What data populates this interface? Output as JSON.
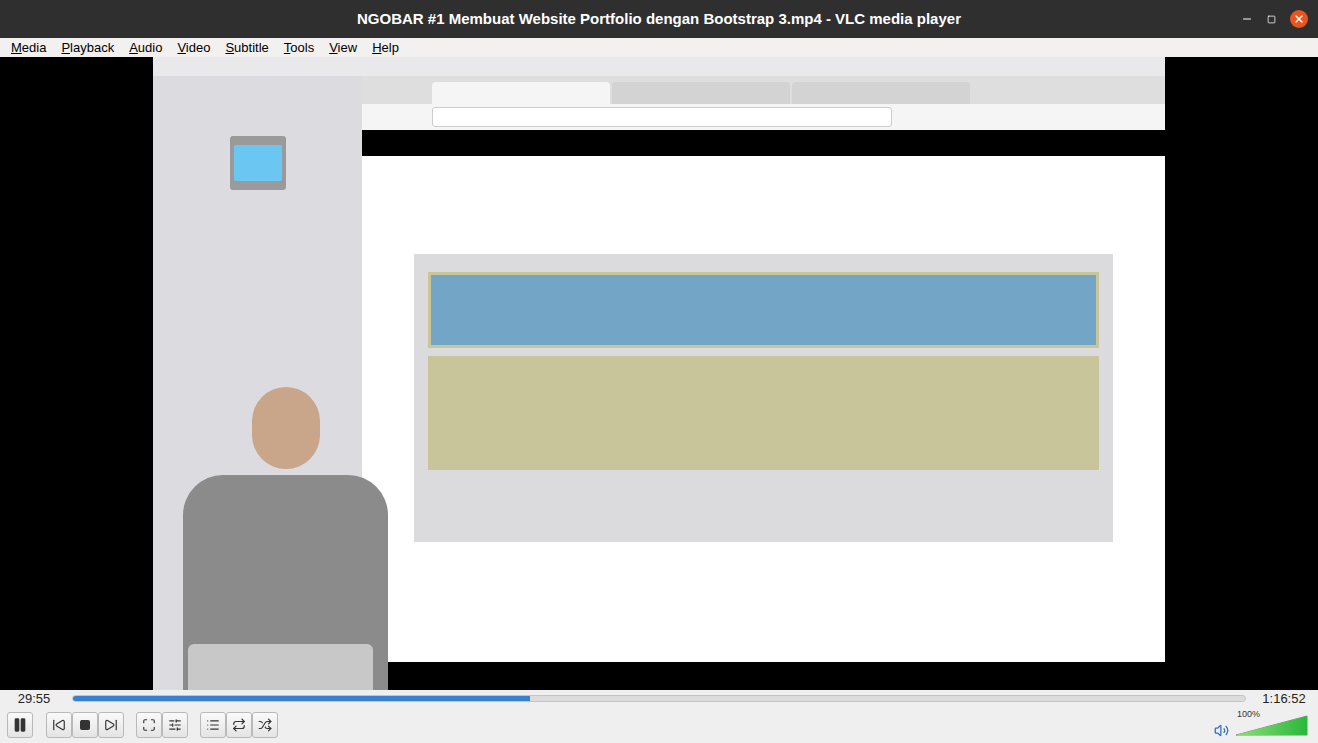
{
  "window": {
    "title": "NGOBAR #1 Membuat Website Portfolio dengan Bootstrap 3.mp4 - VLC media player"
  },
  "menu": [
    "Media",
    "Playback",
    "Audio",
    "Video",
    "Subtitle",
    "Tools",
    "View",
    "Help"
  ],
  "playback": {
    "elapsed": "29:55",
    "total": "1:16:52",
    "level": 0.39,
    "playing": true
  },
  "volume": {
    "reading": "100%",
    "level": 1.0,
    "muted": false
  }
}
